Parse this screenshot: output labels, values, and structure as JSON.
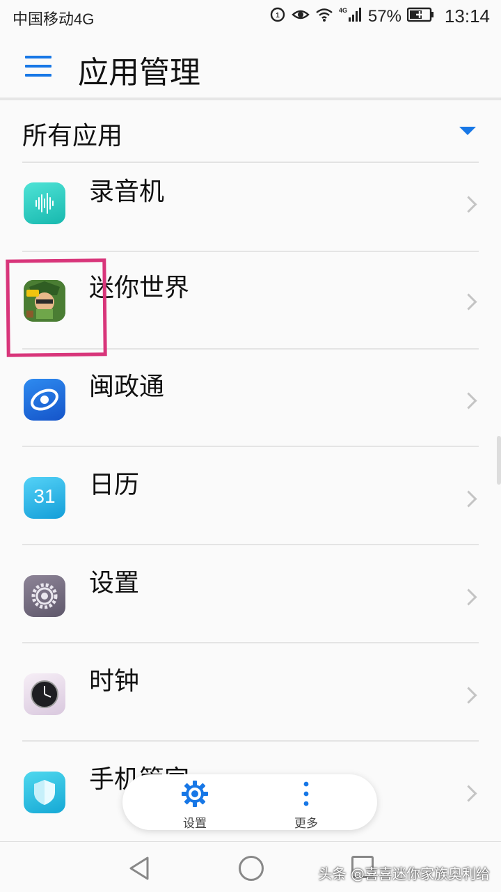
{
  "status_bar": {
    "carrier": "中国移动4G",
    "battery_percent": "57%",
    "time": "13:14",
    "network_badge": "4G",
    "icons": [
      "hd-call-icon",
      "eye-comfort-icon",
      "wifi-icon",
      "signal-icon",
      "battery-charging-icon"
    ]
  },
  "app_bar": {
    "title": "应用管理",
    "menu_icon": "hamburger-menu-icon"
  },
  "filter": {
    "label": "所有应用",
    "dropdown_icon": "triangle-down-icon"
  },
  "apps": [
    {
      "name": "录音机",
      "icon": "recorder-icon"
    },
    {
      "name": "迷你世界",
      "icon": "mini-world-game-icon"
    },
    {
      "name": "闽政通",
      "icon": "minzhengtong-icon"
    },
    {
      "name": "日历",
      "icon": "calendar-icon",
      "icon_text": "31"
    },
    {
      "name": "设置",
      "icon": "settings-gear-icon"
    },
    {
      "name": "时钟",
      "icon": "clock-icon"
    },
    {
      "name": "手机管家",
      "icon": "phone-manager-shield-icon"
    }
  ],
  "floating_actions": [
    {
      "label": "设置",
      "icon": "gear-icon"
    },
    {
      "label": "更多",
      "icon": "more-vertical-icon"
    }
  ],
  "nav_bar": {
    "icons": [
      "back-triangle-icon",
      "home-circle-icon",
      "recent-apps-square-icon"
    ]
  },
  "watermark": "头条 @喜喜迷你家族奥利给",
  "colors": {
    "accent": "#1777e6",
    "highlight": "#d8357a",
    "background": "#fafafa"
  }
}
